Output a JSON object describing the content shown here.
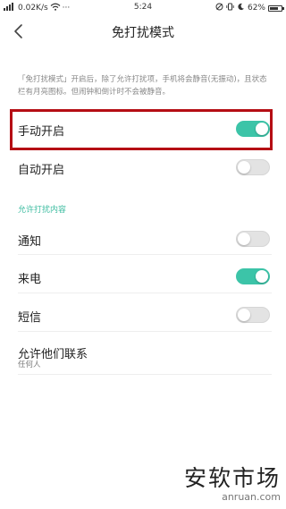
{
  "status_bar": {
    "speed": "0.02K/s",
    "time": "5:24",
    "battery": "62%",
    "battery_level": 0.62
  },
  "header": {
    "title": "免打扰模式",
    "back_icon": "chevron-left-icon"
  },
  "description": "「免打扰模式」开启后，除了允许打扰项，手机将会静音(无振动)，且状态栏有月亮图标。但闹钟和倒计时不会被静音。",
  "settings": {
    "manual": {
      "label": "手动开启",
      "on": true
    },
    "auto": {
      "label": "自动开启",
      "on": false
    }
  },
  "allow_section": {
    "header": "允许打扰内容",
    "items": [
      {
        "label": "通知",
        "on": false
      },
      {
        "label": "来电",
        "on": true
      },
      {
        "label": "短信",
        "on": false
      }
    ],
    "contacts": {
      "label": "允许他们联系",
      "value": "任何人"
    }
  },
  "watermark": {
    "brand": "安软市场",
    "url": "anruan.com"
  },
  "colors": {
    "accent": "#3cc4a8",
    "highlight": "#b50e14"
  }
}
